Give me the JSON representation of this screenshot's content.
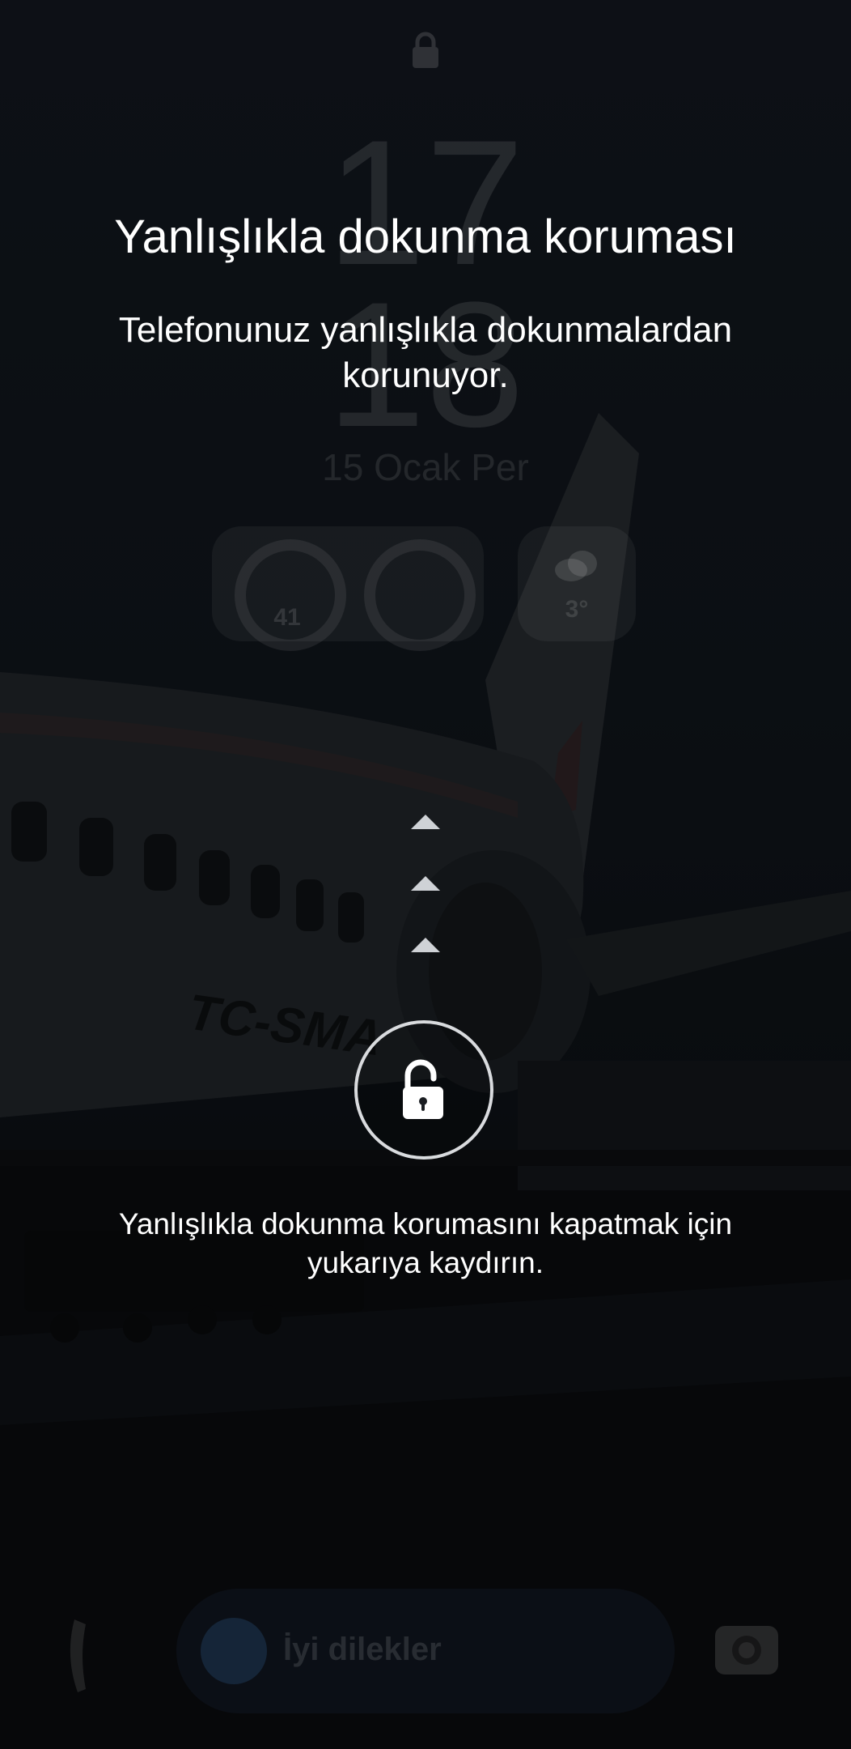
{
  "overlay": {
    "title": "Yanlışlıkla dokunma koruması",
    "subtitle": "Telefonunuz yanlışlıkla dokunmalardan korunuyor.",
    "hint": "Yanlışlıkla dokunma korumasını kapatmak için yukarıya kaydırın.",
    "unlock_icon": "unlock-icon",
    "chevron_icon": "chevron-up-icon"
  },
  "lockscreen": {
    "clock_hour": "17",
    "clock_minute": "18",
    "date": "15 Ocak Per",
    "battery_level": "41",
    "weather_temp": "3°",
    "bottom_pill_text": "İyi dilekler",
    "lock_icon": "lock-icon",
    "phone_icon": "phone-icon",
    "camera_icon": "camera-icon"
  },
  "colors": {
    "text": "#ffffff",
    "ring": "#d9dbde",
    "chevron": "#cfd2d6"
  }
}
